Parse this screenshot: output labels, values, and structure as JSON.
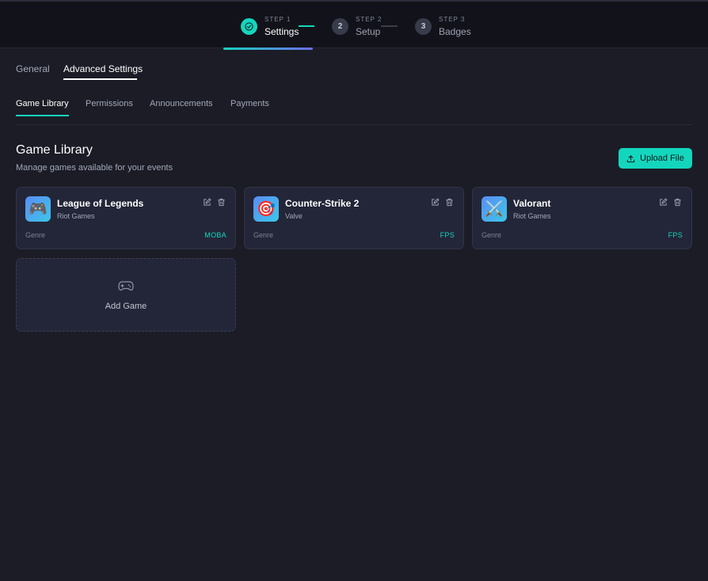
{
  "stepper": {
    "steps": [
      {
        "number": "1",
        "kicker": "STEP 1",
        "label": "Settings",
        "state": "done"
      },
      {
        "number": "2",
        "kicker": "STEP 2",
        "label": "Setup",
        "state": "pending"
      },
      {
        "number": "3",
        "kicker": "STEP 3",
        "label": "Badges",
        "state": "pending"
      }
    ]
  },
  "top_tabs": [
    {
      "label": "General",
      "active": false
    },
    {
      "label": "Advanced Settings",
      "active": true
    }
  ],
  "sub_tabs": [
    {
      "label": "Game Library",
      "active": true
    },
    {
      "label": "Permissions",
      "active": false
    },
    {
      "label": "Announcements",
      "active": false
    },
    {
      "label": "Payments",
      "active": false
    }
  ],
  "section": {
    "title": "Game Library",
    "subtitle": "Manage games available for your events",
    "upload_label": "Upload File"
  },
  "games": [
    {
      "name": "League of Legends",
      "publisher": "Riot Games",
      "genre_label": "Genre",
      "genre": "MOBA",
      "icon": "🎮",
      "icon_name": "game-controller-icon"
    },
    {
      "name": "Counter-Strike 2",
      "publisher": "Valve",
      "genre_label": "Genre",
      "genre": "FPS",
      "icon": "🎯",
      "icon_name": "target-icon"
    },
    {
      "name": "Valorant",
      "publisher": "Riot Games",
      "genre_label": "Genre",
      "genre": "FPS",
      "icon": "⚔️",
      "icon_name": "crossed-swords-icon"
    }
  ],
  "add_game": {
    "label": "Add Game"
  },
  "colors": {
    "accent": "#14d6bd",
    "accent_secondary": "#6e6cf0",
    "background": "#1b1c26",
    "card": "#232638",
    "header": "#12131a"
  }
}
